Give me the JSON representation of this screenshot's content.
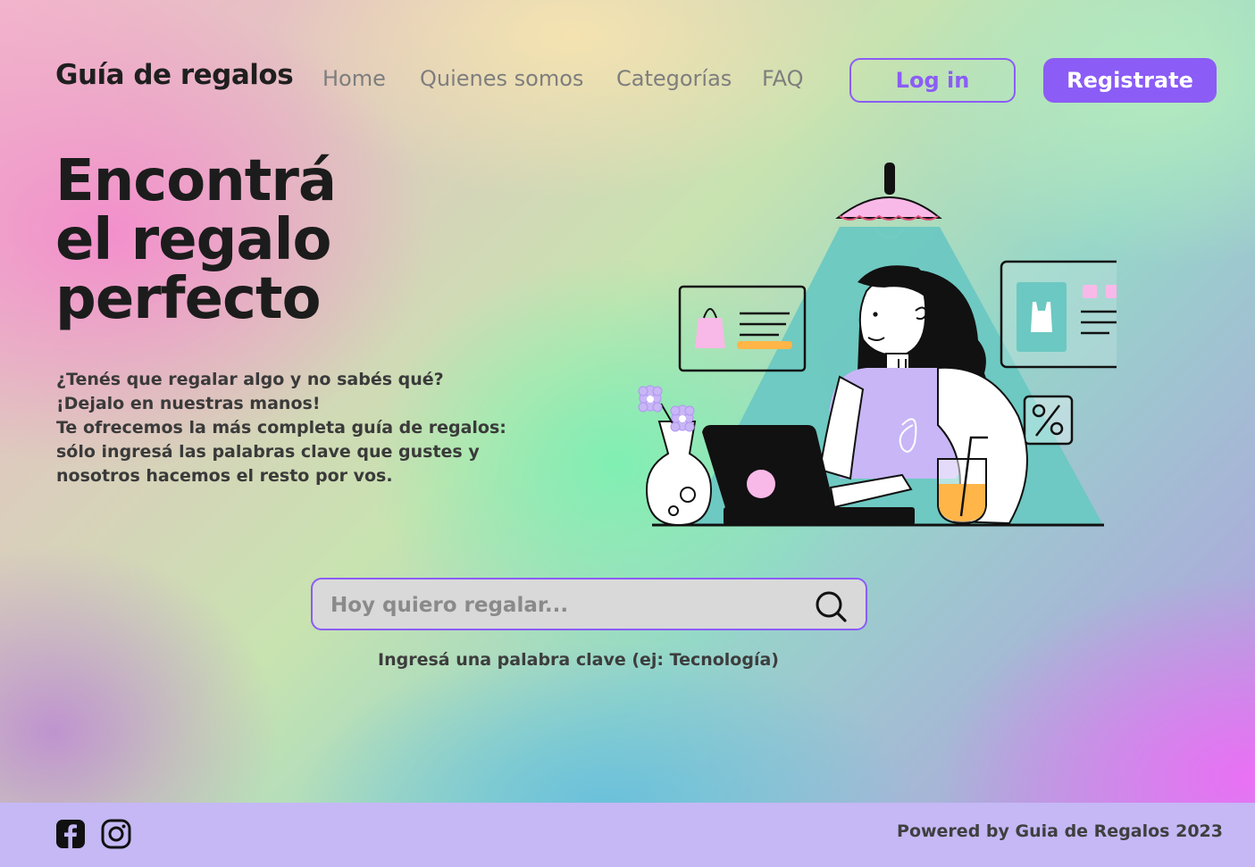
{
  "header": {
    "logo": "Guía de regalos",
    "nav": [
      "Home",
      "Quienes somos",
      "Categorías",
      "FAQ"
    ],
    "login_label": "Log in",
    "register_label": "Registrate"
  },
  "hero": {
    "title_lines": [
      "Encontrá",
      "el regalo",
      "perfecto"
    ],
    "text_lines": [
      "¿Tenés que regalar algo y no sabés qué?",
      "¡Dejalo en nuestras manos!",
      "Te ofrecemos la más completa guía de regalos:",
      "sólo ingresá las palabras clave que gustes y",
      "nosotros hacemos el resto por vos."
    ]
  },
  "search": {
    "placeholder": "Hoy quiero regalar...",
    "hint": "Ingresá una palabra clave (ej: Tecnología)",
    "icon": "search-icon"
  },
  "footer": {
    "social_icons": [
      "facebook-icon",
      "instagram-icon"
    ],
    "credit": "Powered by Guia de Regalos 2023"
  },
  "colors": {
    "accent": "#8b5cf6",
    "footer_bg": "#c5b8f5",
    "search_bg": "#d9d9d9",
    "illustration_teal": "#6cc8c2",
    "illustration_pink": "#f9b9e8",
    "illustration_purple": "#c8b6f6",
    "illustration_orange": "#ffb547"
  }
}
